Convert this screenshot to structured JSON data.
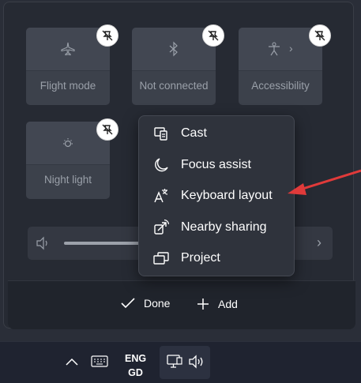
{
  "quick_settings": {
    "tiles": [
      {
        "label": "Flight mode",
        "icon": "airplane-icon"
      },
      {
        "label": "Not connected",
        "icon": "bluetooth-icon"
      },
      {
        "label": "Accessibility",
        "icon": "accessibility-icon",
        "has_chevron": true
      },
      {
        "label": "Night light",
        "icon": "night-light-icon"
      }
    ],
    "chevron": "›",
    "slider_arrow": "›"
  },
  "add_menu": {
    "items": [
      {
        "label": "Cast",
        "icon": "cast-icon"
      },
      {
        "label": "Focus assist",
        "icon": "moon-icon"
      },
      {
        "label": "Keyboard layout",
        "icon": "keyboard-layout-icon"
      },
      {
        "label": "Nearby sharing",
        "icon": "nearby-sharing-icon"
      },
      {
        "label": "Project",
        "icon": "project-icon"
      }
    ]
  },
  "footer": {
    "done_label": "Done",
    "add_label": "Add"
  },
  "taskbar": {
    "lang_line1": "ENG",
    "lang_line2": "GD"
  },
  "colors": {
    "accent_arrow": "#e03a3a",
    "panel_bg": "#262a33",
    "tile_bg": "#3c414b"
  }
}
